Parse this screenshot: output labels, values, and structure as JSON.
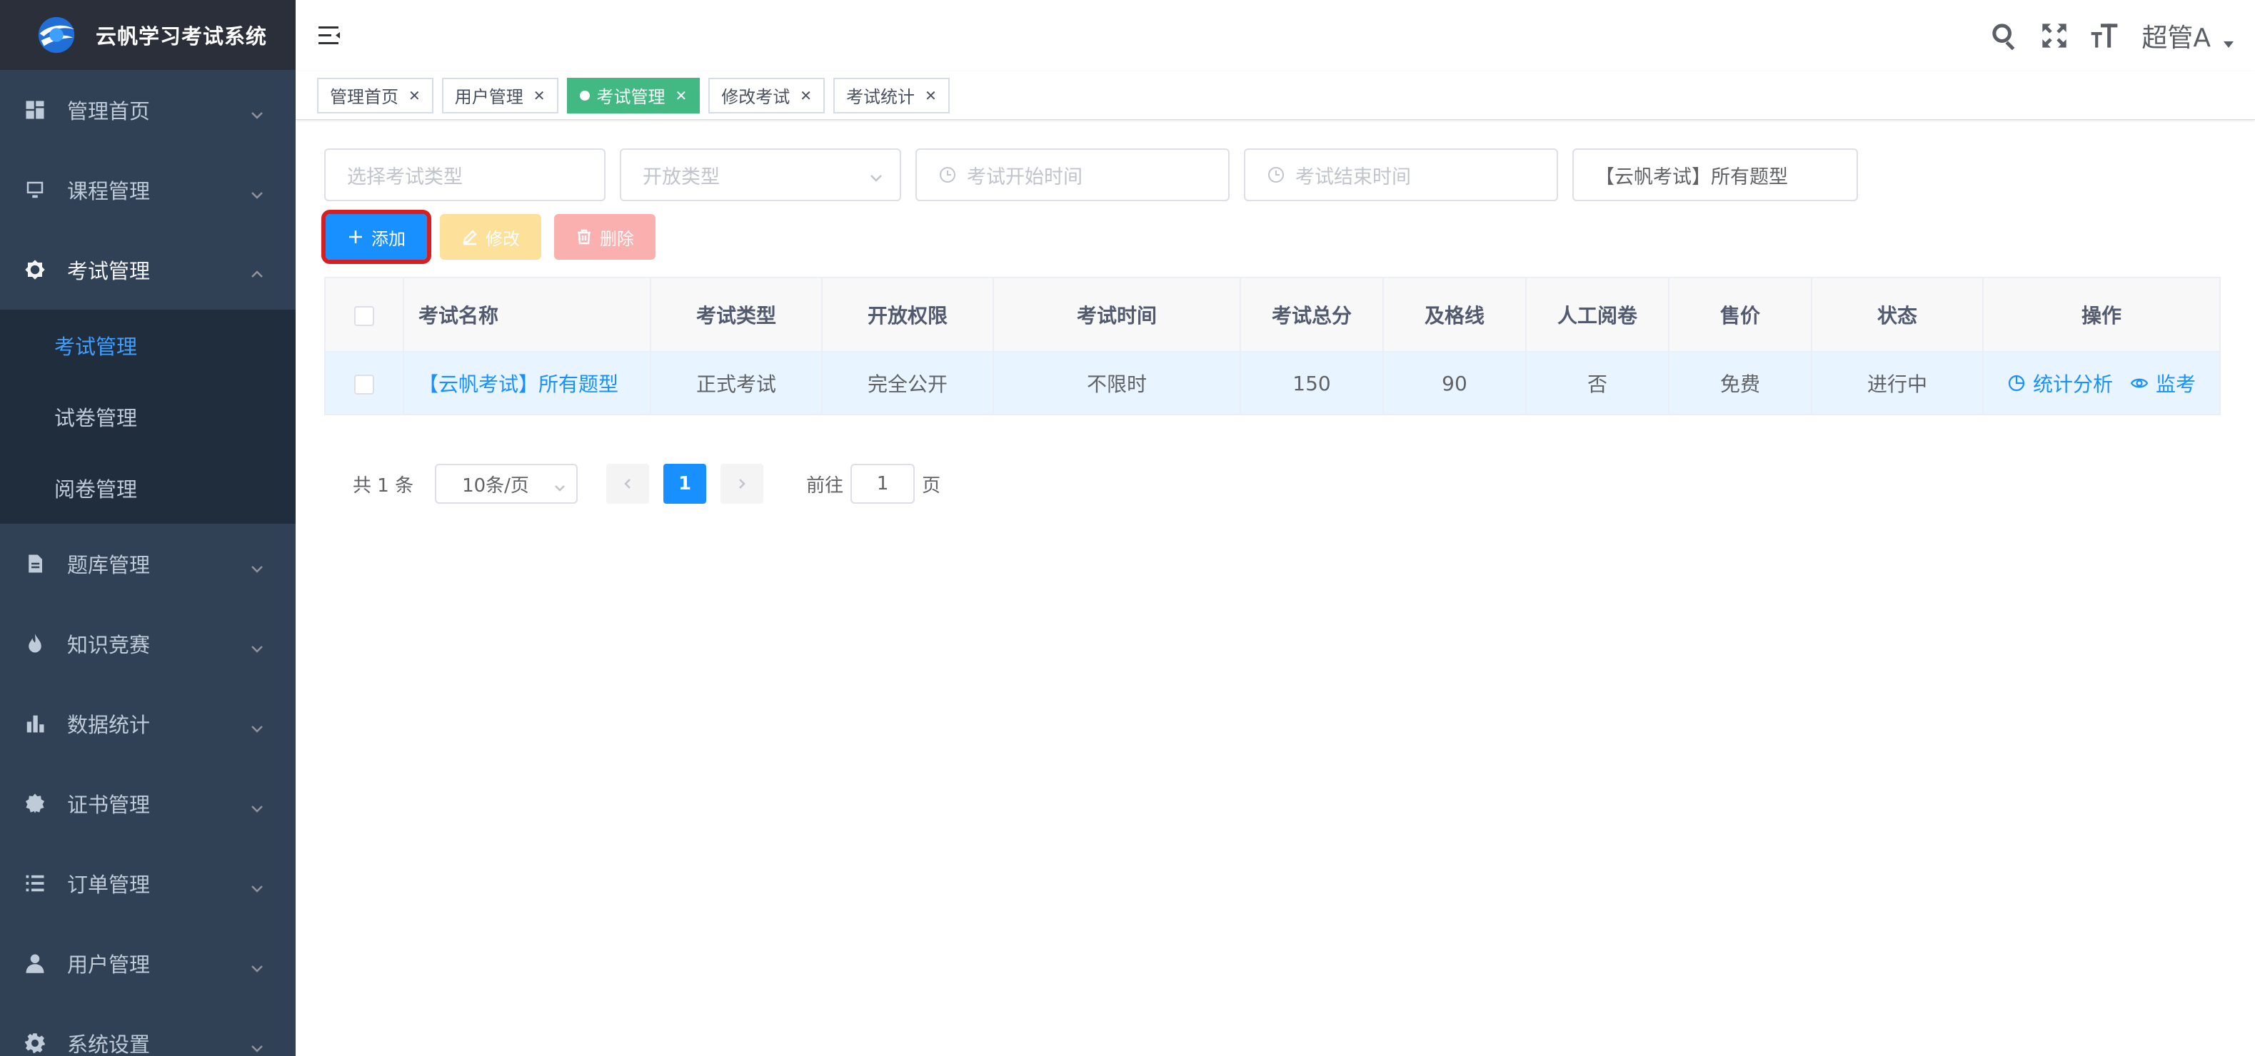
{
  "app": {
    "title": "云帆学习考试系统"
  },
  "sidebar": {
    "items": [
      {
        "label": "管理首页",
        "icon": "dashboard-icon"
      },
      {
        "label": "课程管理",
        "icon": "course-icon"
      },
      {
        "label": "考试管理",
        "icon": "exam-icon",
        "expanded": true,
        "children": [
          {
            "label": "考试管理",
            "active": true
          },
          {
            "label": "试卷管理"
          },
          {
            "label": "阅卷管理"
          }
        ]
      },
      {
        "label": "题库管理",
        "icon": "document-icon"
      },
      {
        "label": "知识竞赛",
        "icon": "fire-icon"
      },
      {
        "label": "数据统计",
        "icon": "bar-chart-icon"
      },
      {
        "label": "证书管理",
        "icon": "certificate-icon"
      },
      {
        "label": "订单管理",
        "icon": "list-icon"
      },
      {
        "label": "用户管理",
        "icon": "user-icon"
      },
      {
        "label": "系统设置",
        "icon": "gear-icon"
      }
    ]
  },
  "header": {
    "user": "超管A"
  },
  "tags": [
    {
      "label": "管理首页",
      "active": false
    },
    {
      "label": "用户管理",
      "active": false
    },
    {
      "label": "考试管理",
      "active": true
    },
    {
      "label": "修改考试",
      "active": false
    },
    {
      "label": "考试统计",
      "active": false
    }
  ],
  "filters": {
    "exam_type_placeholder": "选择考试类型",
    "open_type_placeholder": "开放类型",
    "start_time_placeholder": "考试开始时间",
    "end_time_placeholder": "考试结束时间",
    "title_value": "【云帆考试】所有题型"
  },
  "toolbar": {
    "add_label": "添加",
    "edit_label": "修改",
    "delete_label": "删除"
  },
  "table": {
    "headers": [
      "考试名称",
      "考试类型",
      "开放权限",
      "考试时间",
      "考试总分",
      "及格线",
      "人工阅卷",
      "售价",
      "状态",
      "操作"
    ],
    "rows": [
      {
        "name": "【云帆考试】所有题型",
        "type": "正式考试",
        "open": "完全公开",
        "time": "不限时",
        "total": "150",
        "pass": "90",
        "manual": "否",
        "price": "免费",
        "status": "进行中",
        "op_stats": "统计分析",
        "op_monitor": "监考"
      }
    ]
  },
  "pagination": {
    "total_text": "共 1 条",
    "page_size": "10条/页",
    "current": "1",
    "goto_label": "前往",
    "goto_value": "1",
    "page_suffix": "页"
  },
  "colors": {
    "sidebar_bg": "#304156",
    "primary": "#1890ff",
    "tag_active": "#42b983",
    "free": "#13ce66",
    "highlight_outline": "#d71f1f"
  }
}
